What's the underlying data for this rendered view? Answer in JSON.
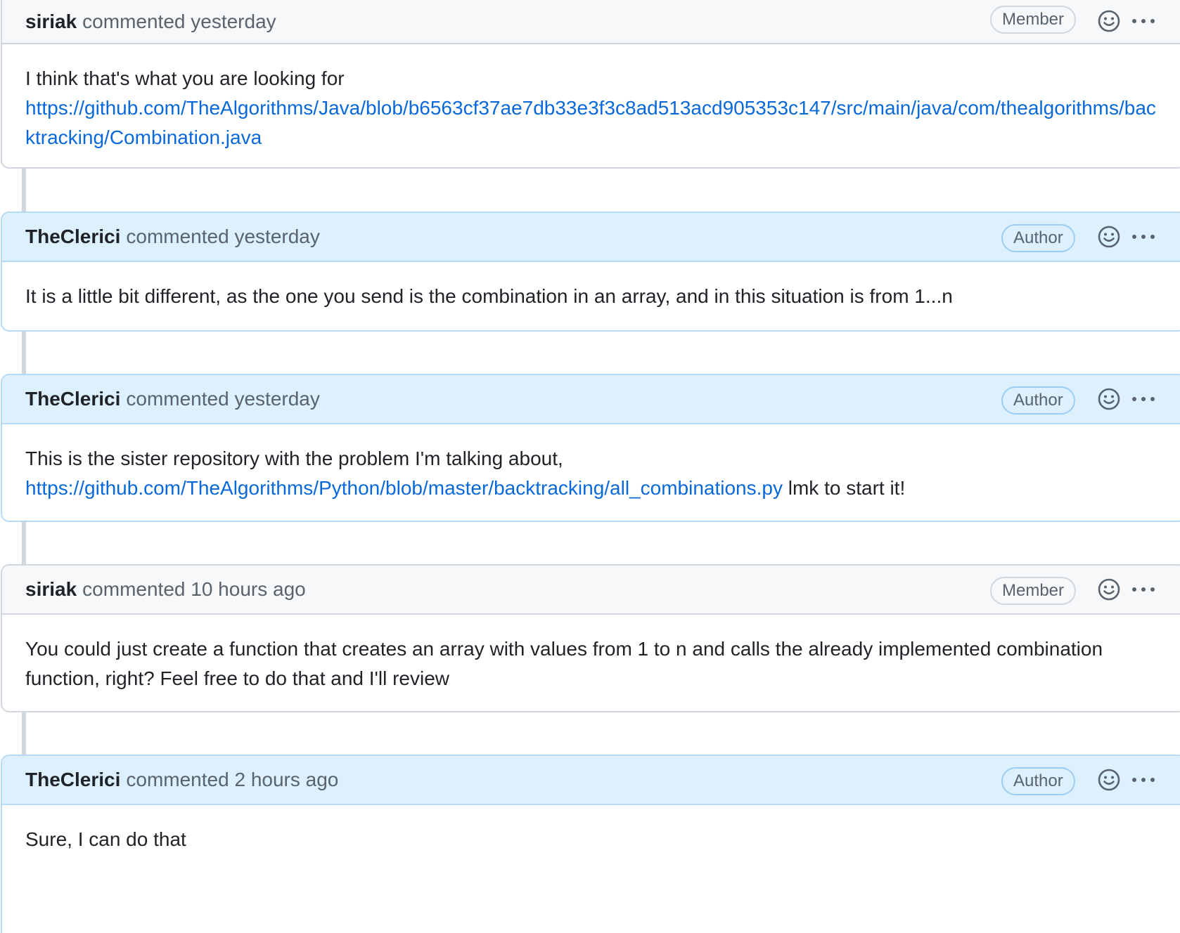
{
  "comments": [
    {
      "user": "siriak",
      "action": "commented",
      "time": "yesterday",
      "role": "Member",
      "body_text": "I think that's what you are looking for",
      "link": "https://github.com/TheAlgorithms/Java/blob/b6563cf37ae7db33e3f3c8ad513acd905353c147/src/main/java/com/thealgorithms/backtracking/Combination.java"
    },
    {
      "user": "TheClerici",
      "action": "commented",
      "time": "yesterday",
      "role": "Author",
      "body_text": "It is a little bit different, as the one you send is the combination in an array, and in this situation is from 1...n"
    },
    {
      "user": "TheClerici",
      "action": "commented",
      "time": "yesterday",
      "role": "Author",
      "body_text": "This is the sister repository with the problem I'm talking about,",
      "link": "https://github.com/TheAlgorithms/Python/blob/master/backtracking/all_combinations.py",
      "body_after": " lmk to start it!"
    },
    {
      "user": "siriak",
      "action": "commented",
      "time": "10 hours ago",
      "role": "Member",
      "body_text": "You could just create a function that creates an array with values from 1 to n and calls the already implemented combination function, right? Feel free to do that and I'll review"
    },
    {
      "user": "TheClerici",
      "action": "commented",
      "time": "2 hours ago",
      "role": "Author",
      "body_text": "Sure, I can do that"
    }
  ],
  "icons": {
    "react": "smiley-icon",
    "more": "kebab-horizontal-icon"
  },
  "colors": {
    "link": "#0969da",
    "author_header_bg": "#ddf0fd",
    "member_header_bg": "#f6f8fa",
    "border": "#d0d7de",
    "author_border": "#b6daf5"
  }
}
